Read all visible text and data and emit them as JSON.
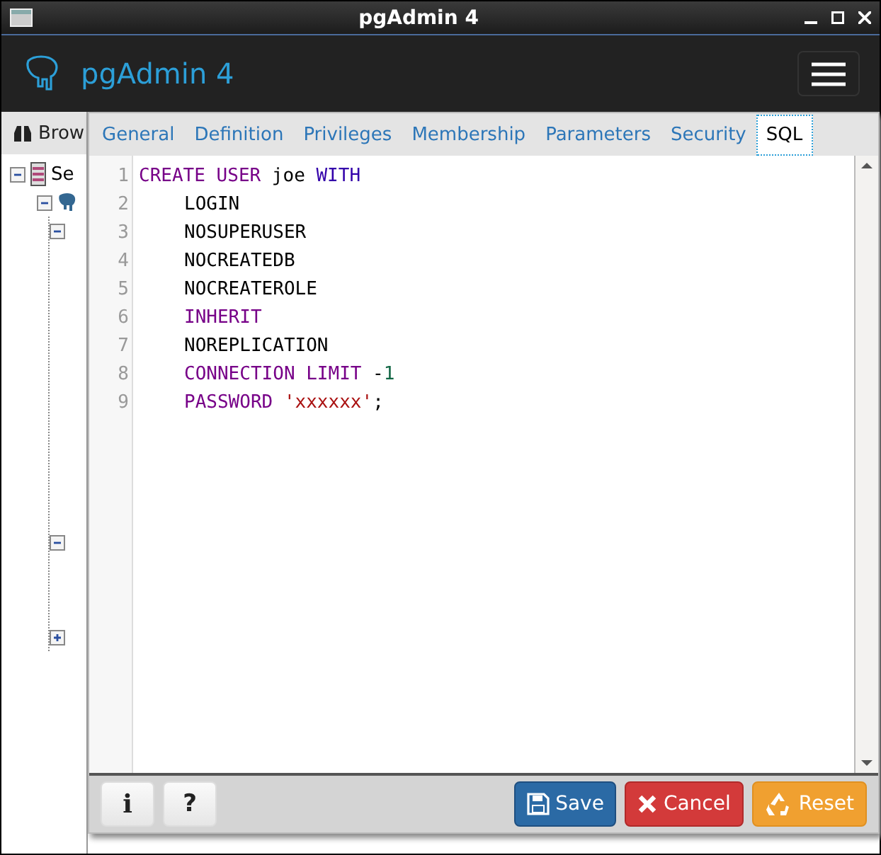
{
  "window": {
    "title": "pgAdmin 4"
  },
  "app_header": {
    "title": "pgAdmin 4"
  },
  "browser": {
    "title": "Brow",
    "tree": [
      {
        "label": "Se",
        "expanded": true,
        "children": [
          {
            "expanded": true,
            "children": [
              {
                "expanded": true
              },
              {
                "expanded": true
              },
              {
                "expanded": false
              }
            ]
          }
        ]
      }
    ]
  },
  "tabs": [
    {
      "label": "General",
      "selected": false
    },
    {
      "label": "Definition",
      "selected": false
    },
    {
      "label": "Privileges",
      "selected": false
    },
    {
      "label": "Membership",
      "selected": false
    },
    {
      "label": "Parameters",
      "selected": false
    },
    {
      "label": "Security",
      "selected": false
    },
    {
      "label": "SQL",
      "selected": true
    }
  ],
  "sql_editor": {
    "lines": [
      {
        "number": "1",
        "indented": false,
        "tokens": [
          {
            "kind": "keyword",
            "text": "CREATE USER"
          },
          {
            "kind": "plain",
            "text": " joe "
          },
          {
            "kind": "builtin",
            "text": "WITH"
          }
        ]
      },
      {
        "number": "2",
        "indented": true,
        "tokens": [
          {
            "kind": "plain",
            "text": "LOGIN"
          }
        ]
      },
      {
        "number": "3",
        "indented": true,
        "tokens": [
          {
            "kind": "plain",
            "text": "NOSUPERUSER"
          }
        ]
      },
      {
        "number": "4",
        "indented": true,
        "tokens": [
          {
            "kind": "plain",
            "text": "NOCREATEDB"
          }
        ]
      },
      {
        "number": "5",
        "indented": true,
        "tokens": [
          {
            "kind": "plain",
            "text": "NOCREATEROLE"
          }
        ]
      },
      {
        "number": "6",
        "indented": true,
        "tokens": [
          {
            "kind": "keyword",
            "text": "INHERIT"
          }
        ]
      },
      {
        "number": "7",
        "indented": true,
        "tokens": [
          {
            "kind": "plain",
            "text": "NOREPLICATION"
          }
        ]
      },
      {
        "number": "8",
        "indented": true,
        "tokens": [
          {
            "kind": "keyword",
            "text": "CONNECTION LIMIT"
          },
          {
            "kind": "plain",
            "text": " -"
          },
          {
            "kind": "number",
            "text": "1"
          }
        ]
      },
      {
        "number": "9",
        "indented": true,
        "tokens": [
          {
            "kind": "keyword",
            "text": "PASSWORD"
          },
          {
            "kind": "string",
            "text": "'xxxxxx'",
            "space_before": true
          },
          {
            "kind": "plain",
            "text": ";"
          }
        ]
      }
    ]
  },
  "footer": {
    "left_buttons": [
      {
        "kind": "info",
        "label": "i"
      },
      {
        "kind": "help",
        "label": "?"
      }
    ],
    "right_buttons": [
      {
        "kind": "save",
        "label": "Save"
      },
      {
        "kind": "cancel",
        "label": "Cancel"
      },
      {
        "kind": "reset",
        "label": "Reset"
      }
    ]
  }
}
